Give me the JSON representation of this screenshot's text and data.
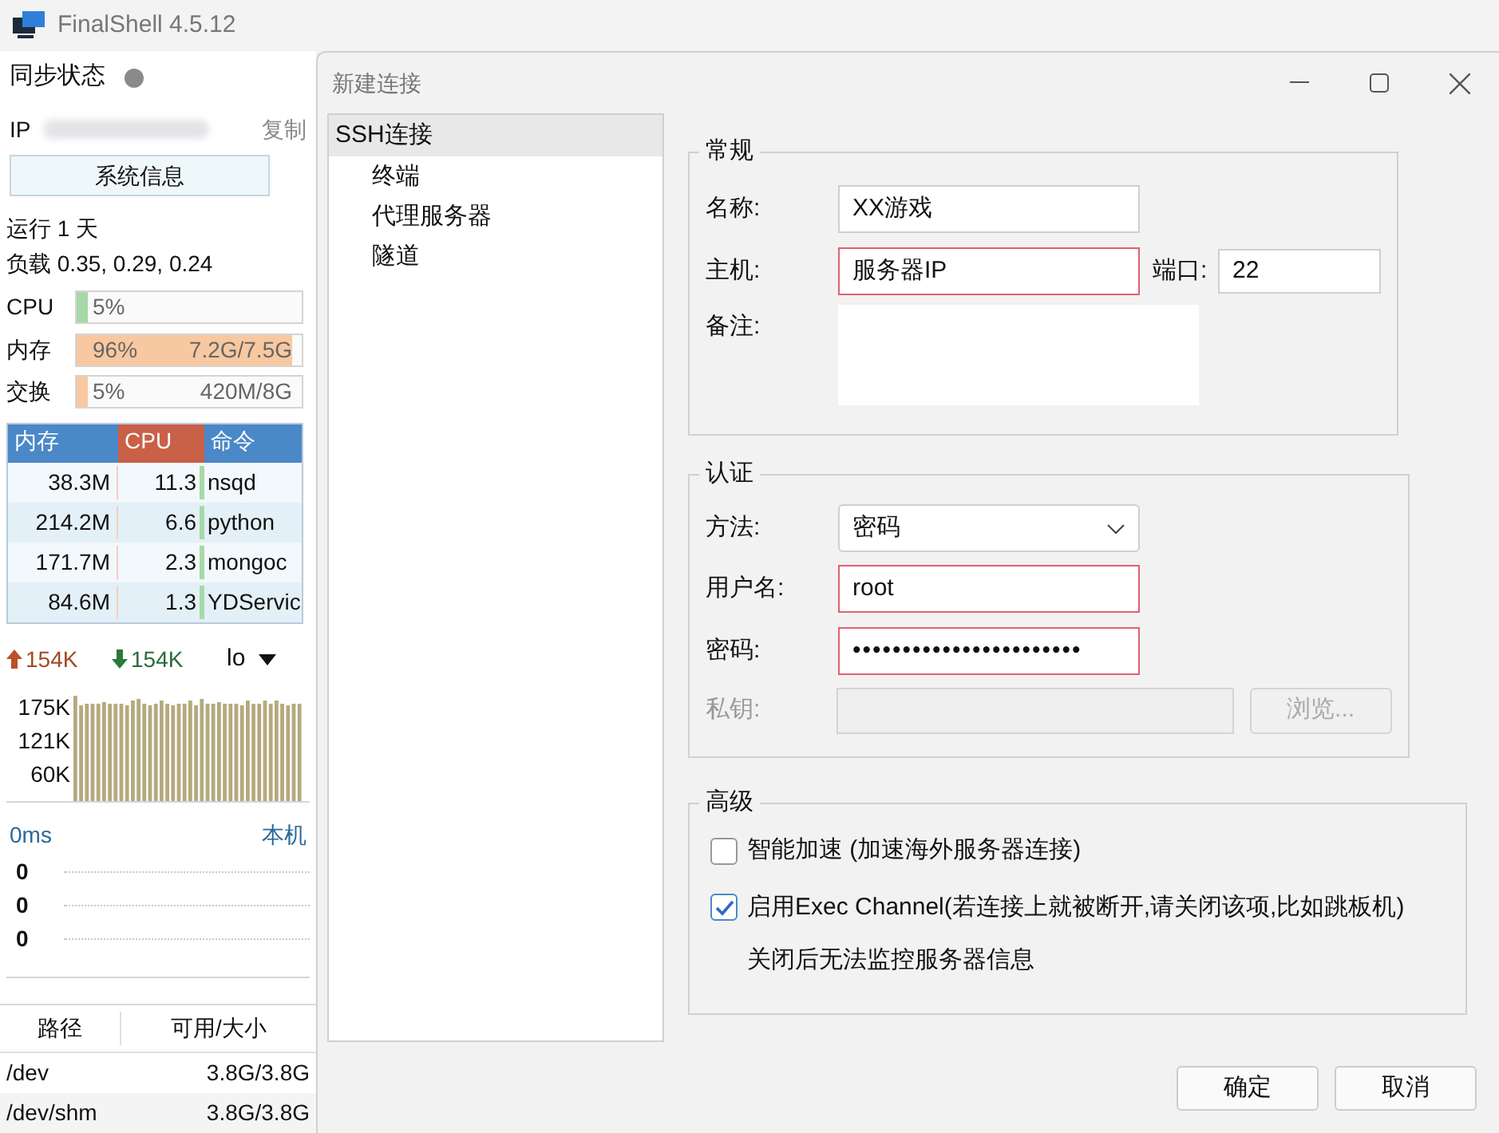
{
  "app": {
    "title": "FinalShell 4.5.12"
  },
  "sidebar": {
    "sync_label": "同步状态",
    "ip_label": "IP",
    "copy_link": "复制",
    "sysinfo_button": "系统信息",
    "uptime": "运行 1 天",
    "load": "负载 0.35, 0.29, 0.24",
    "meters": [
      {
        "label": "CPU",
        "level": 0.05,
        "color": "#a8d8a8",
        "percent": "5%"
      },
      {
        "label": "内存",
        "level": 0.96,
        "color": "#f8c8a0",
        "percent": "96%",
        "detail": "7.2G/7.5G"
      },
      {
        "label": "交换",
        "level": 0.05,
        "color": "#f8c8a0",
        "percent": "5%",
        "detail": "420M/8G"
      }
    ],
    "process_table": {
      "columns": [
        "内存",
        "CPU",
        "命令"
      ],
      "rows": [
        {
          "mem": "38.3M",
          "cpu": "11.3",
          "cmd": "nsqd"
        },
        {
          "mem": "214.2M",
          "cpu": "6.6",
          "cmd": "python"
        },
        {
          "mem": "171.7M",
          "cpu": "2.3",
          "cmd": "mongoc"
        },
        {
          "mem": "84.6M",
          "cpu": "1.3",
          "cmd": "YDServic"
        }
      ]
    },
    "network": {
      "upload": "154K",
      "download": "154K",
      "interface": "lo",
      "scale_labels": [
        "175K",
        "121K",
        "60K"
      ]
    },
    "ping": {
      "latency": "0ms",
      "target": "本机",
      "rows": [
        "0",
        "0",
        "0"
      ]
    },
    "disk_table": {
      "columns": [
        "路径",
        "可用/大小"
      ],
      "rows": [
        {
          "path": "/dev",
          "size": "3.8G/3.8G"
        },
        {
          "path": "/dev/shm",
          "size": "3.8G/3.8G"
        }
      ]
    }
  },
  "dialog": {
    "title": "新建连接",
    "nav_tree": [
      {
        "label": "SSH连接",
        "selected": true,
        "children": [
          {
            "label": "终端",
            "selected": false
          },
          {
            "label": "代理服务器",
            "selected": false
          },
          {
            "label": "隧道",
            "selected": false
          }
        ]
      }
    ],
    "general": {
      "title": "常规",
      "name_label": "名称:",
      "name": {
        "value": "XX游戏",
        "invalid": false
      },
      "host_label": "主机:",
      "host": {
        "value": "服务器IP",
        "invalid": true
      },
      "port_label": "端口:",
      "port": "22",
      "note_label": "备注:"
    },
    "auth": {
      "title": "认证",
      "method_label": "方法:",
      "method": "密码",
      "username_label": "用户名:",
      "username": {
        "value": "root",
        "invalid": true
      },
      "password_label": "密码:",
      "password": {
        "value": "•••••••••••••••••••••••",
        "invalid": true
      },
      "key_label": "私钥:",
      "key_disabled": true,
      "browse_button": "浏览..."
    },
    "advanced": {
      "title": "高级",
      "options": [
        {
          "label": "智能加速 (加速海外服务器连接)",
          "checked": false
        },
        {
          "label": "启用Exec Channel(若连接上就被断开,请关闭该项,比如跳板机)",
          "checked": true
        }
      ],
      "note": "关闭后无法监控服务器信息"
    },
    "buttons": [
      "确定",
      "取消"
    ]
  }
}
